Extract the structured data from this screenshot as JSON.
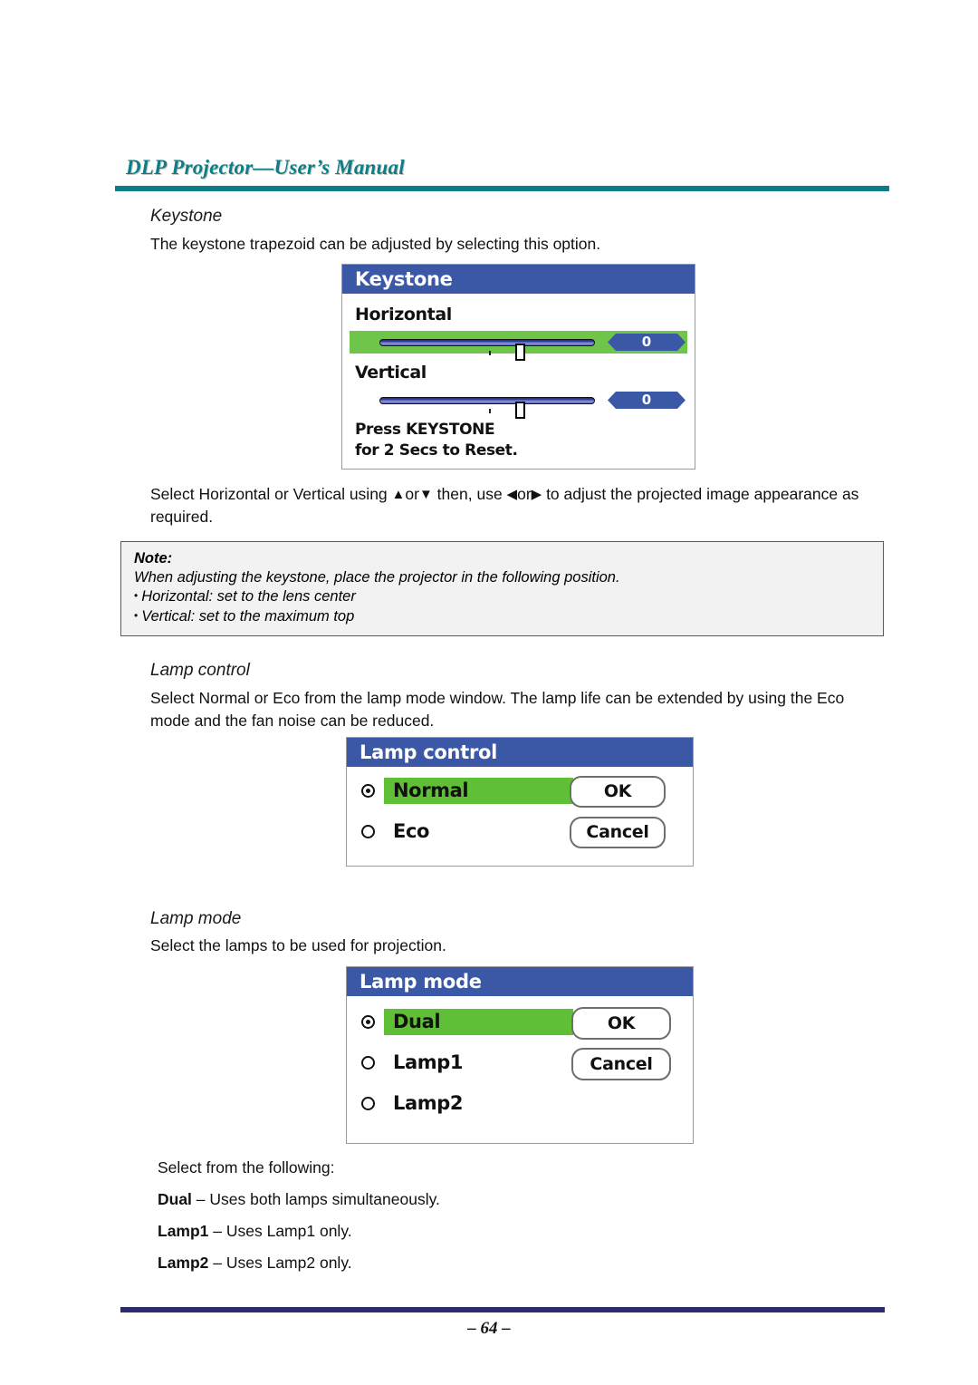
{
  "header": {
    "title": "DLP Projector—User’s Manual"
  },
  "sections": {
    "keystone": {
      "heading": "Keystone",
      "intro": "The keystone trapezoid can be adjusted by selecting this option.",
      "instructions_pre": "Select Horizontal or Vertical using ",
      "arrow_up": "▲",
      "instructions_or1": "or",
      "arrow_down": "▼",
      "instructions_mid": " then, use ",
      "arrow_left": "◀",
      "instructions_or2": "or",
      "arrow_right": "▶",
      "instructions_post": " to adjust the projected image appearance as required."
    },
    "lamp_control": {
      "heading": "Lamp control",
      "intro": "Select Normal or Eco from the lamp mode window. The lamp life can be extended by using the Eco mode and the fan noise can be reduced."
    },
    "lamp_mode": {
      "heading": "Lamp mode",
      "intro": "Select the lamps to be used for projection.",
      "select_prompt": "Select from the following:",
      "definitions": [
        {
          "term": "Dual",
          "desc": " – Uses both lamps simultaneously."
        },
        {
          "term": "Lamp1",
          "desc": " – Uses Lamp1 only."
        },
        {
          "term": "Lamp2",
          "desc": " – Uses Lamp2 only."
        }
      ]
    }
  },
  "note": {
    "title": "Note:",
    "line1": "When adjusting the keystone, place the projector in the following position.",
    "bullet1": "Horizontal: set to the lens center",
    "bullet2": "Vertical: set to the maximum top"
  },
  "osd_keystone": {
    "title": "Keystone",
    "horizontal_label": "Horizontal",
    "horizontal_value": "0",
    "vertical_label": "Vertical",
    "vertical_value": "0",
    "reset_line1": "Press KEYSTONE",
    "reset_line2": "for 2 Secs to Reset."
  },
  "osd_lamp_control": {
    "title": "Lamp control",
    "options": [
      {
        "label": "Normal",
        "selected": true
      },
      {
        "label": "Eco",
        "selected": false
      }
    ],
    "ok_label": "OK",
    "cancel_label": "Cancel"
  },
  "osd_lamp_mode": {
    "title": "Lamp mode",
    "options": [
      {
        "label": "Dual",
        "selected": true
      },
      {
        "label": "Lamp1",
        "selected": false
      },
      {
        "label": "Lamp2",
        "selected": false
      }
    ],
    "ok_label": "OK",
    "cancel_label": "Cancel"
  },
  "footer": {
    "page_number": "– 64 –"
  },
  "colors": {
    "header_teal": "#0d7f84",
    "osd_title_blue": "#3a58a6",
    "highlight_green": "#5fc038",
    "footer_navy": "#2a2c6b"
  }
}
